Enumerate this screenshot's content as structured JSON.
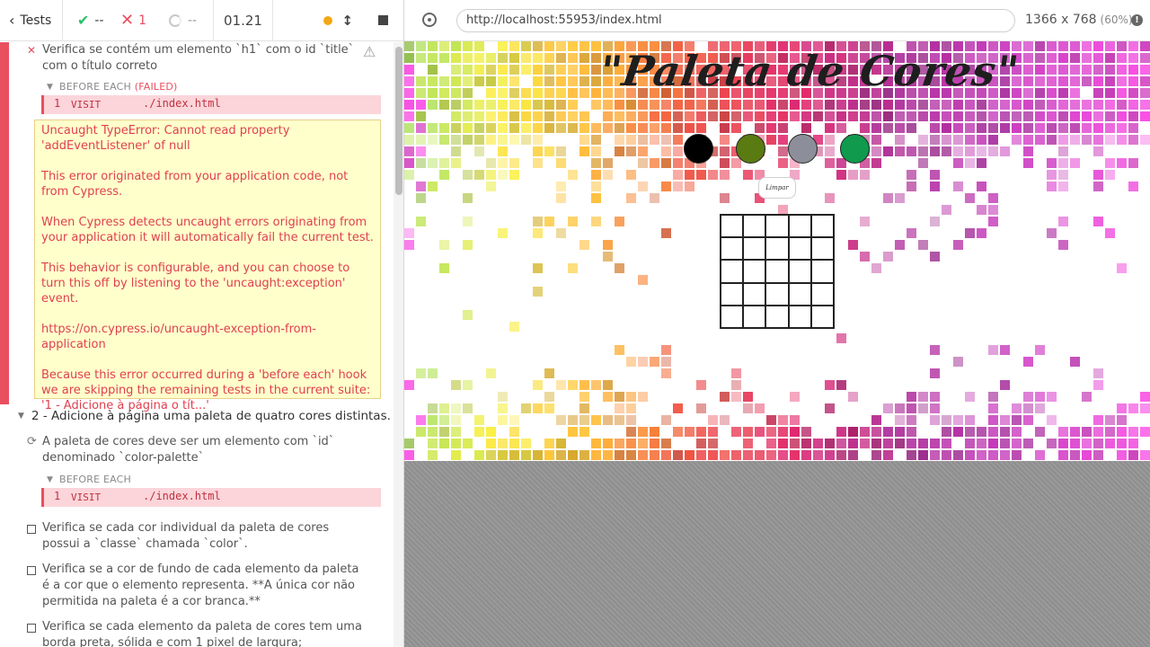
{
  "header": {
    "tests_label": "Tests",
    "passed": "--",
    "failed": "1",
    "pending": "--",
    "duration": "01.21"
  },
  "test1": {
    "title": "Verifica se contém um elemento `h1` com o id `title` com o título correto",
    "hook_name": "BEFORE EACH",
    "hook_status": "(FAILED)",
    "command": {
      "num": "1",
      "name": "VISIT",
      "arg": "./index.html"
    },
    "error": {
      "lines": [
        "Uncaught TypeError: Cannot read property 'addEventListener' of null",
        "This error originated from your application code, not from Cypress.",
        "When Cypress detects uncaught errors originating from your application it will automatically fail the current test.",
        "This behavior is configurable, and you can choose to turn this off by listening to the 'uncaught:exception' event.",
        "https://on.cypress.io/uncaught-exception-from-application",
        "Because this error occurred during a 'before each' hook we are skipping the remaining tests in the current suite: '1 - Adicione à página o tít...'"
      ]
    }
  },
  "suite2": {
    "title": "2 - Adicione à página uma paleta de quatro cores distintas.",
    "test_running": {
      "title": "A paleta de cores deve ser um elemento com `id` denominado `color-palette`",
      "hook_name": "BEFORE EACH",
      "command": {
        "num": "1",
        "name": "VISIT",
        "arg": "./index.html"
      }
    },
    "tests_pending": [
      "Verifica se cada cor individual da paleta de cores possui a `classe` chamada `color`.",
      "Verifica se a cor de fundo de cada elemento da paleta é a cor que o elemento representa. **A única cor não permitida na paleta é a cor branca.**",
      "Verifica se cada elemento da paleta de cores tem uma borda preta, sólida e com 1 pixel de largura;"
    ]
  },
  "aut": {
    "url": "http://localhost:55953/index.html",
    "viewport": "1366 x 768",
    "scale": "(60%)",
    "page": {
      "title": "\"Paleta de Cores\"",
      "palette": [
        "#000000",
        "#5a7a12",
        "#8c8f99",
        "#0f9a4e"
      ],
      "clear_button": "Limpar"
    }
  }
}
